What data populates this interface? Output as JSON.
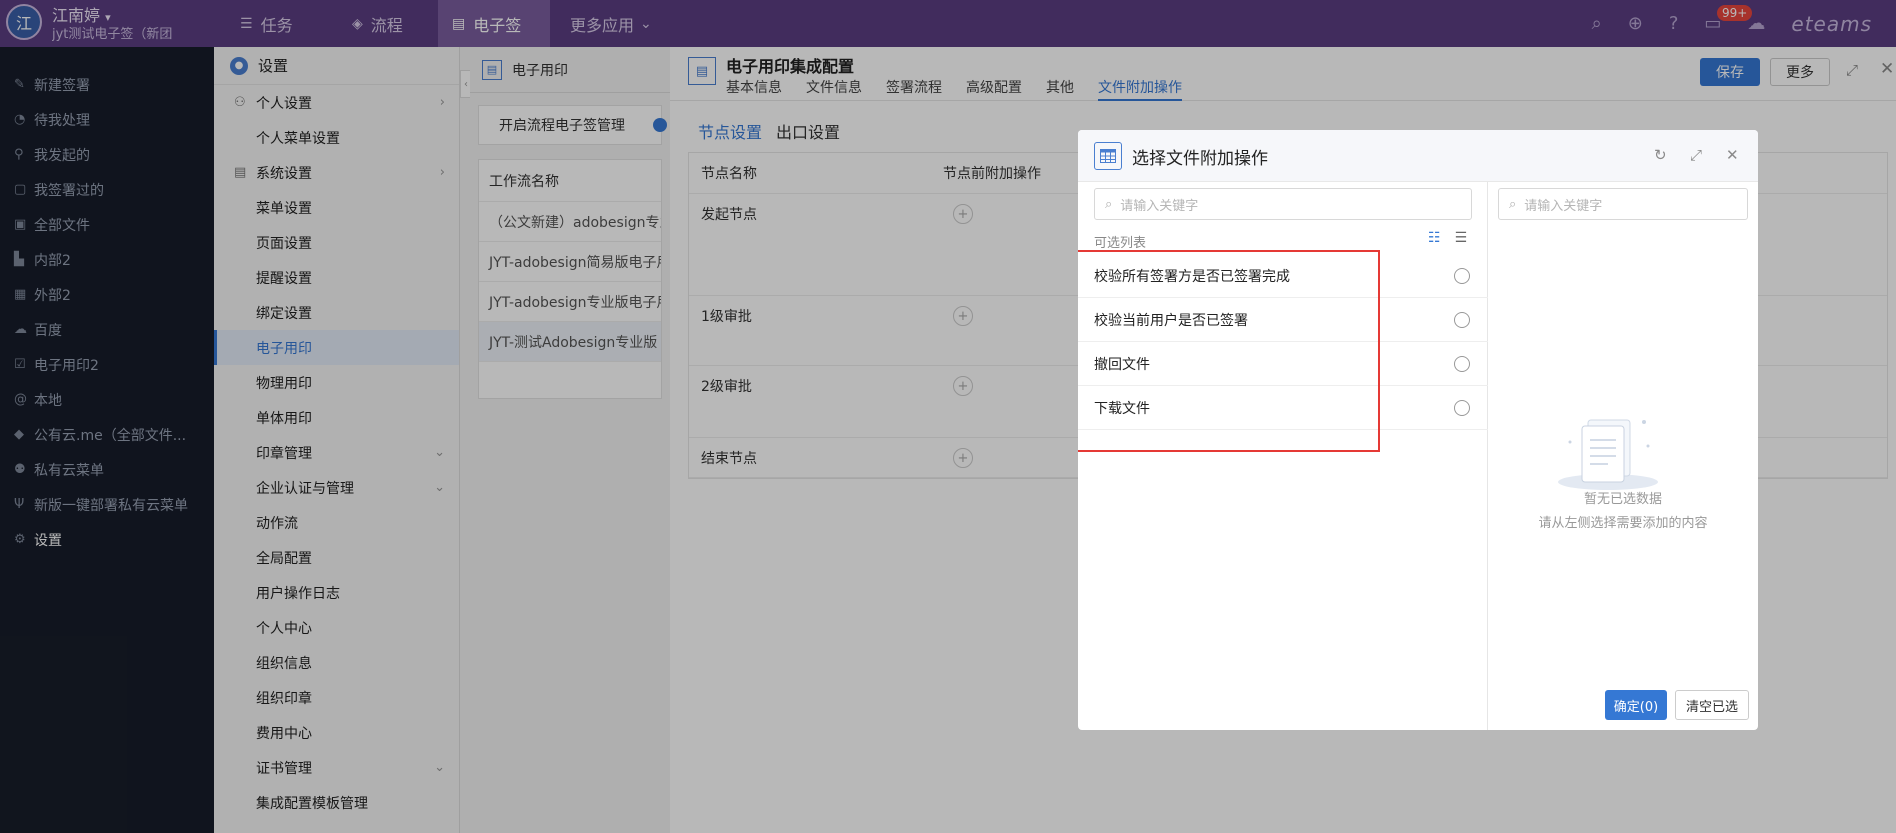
{
  "topbar": {
    "avatar": "江",
    "user_name": "江南婷",
    "user_org": "jyt测试电子签（新团",
    "nav": [
      {
        "label": "任务",
        "icon": "list-icon"
      },
      {
        "label": "流程",
        "icon": "workflow-icon"
      },
      {
        "label": "电子签",
        "icon": "doc-sign-icon"
      },
      {
        "label": "更多应用",
        "icon": "chevron-down-icon"
      }
    ],
    "badge": "99+",
    "brand": "eteams"
  },
  "leftnav": {
    "items": [
      {
        "label": "新建签署",
        "icon": "new-sign-icon"
      },
      {
        "label": "待我处理",
        "icon": "pending-icon"
      },
      {
        "label": "我发起的",
        "icon": "initiated-icon"
      },
      {
        "label": "我签署过的",
        "icon": "signed-icon"
      },
      {
        "label": "全部文件",
        "icon": "files-icon"
      },
      {
        "label": "内部2",
        "icon": "chart-icon"
      },
      {
        "label": "外部2",
        "icon": "grid-icon"
      },
      {
        "label": "百度",
        "icon": "cloud-icon"
      },
      {
        "label": "电子用印2",
        "icon": "check-icon"
      },
      {
        "label": "本地",
        "icon": "at-icon"
      },
      {
        "label": "公有云.me（全部文件...",
        "icon": "layers-icon"
      },
      {
        "label": "私有云菜单",
        "icon": "users-icon"
      },
      {
        "label": "新版一键部署私有云菜单",
        "icon": "fork-icon"
      },
      {
        "label": "设置",
        "icon": "gear-icon"
      }
    ]
  },
  "settings_menu": {
    "header": "设置",
    "items": [
      {
        "label": "个人设置",
        "type": "group",
        "icon": "person-icon",
        "arrow": "right"
      },
      {
        "label": "个人菜单设置",
        "type": "item"
      },
      {
        "label": "系统设置",
        "type": "group",
        "icon": "system-icon",
        "arrow": "right"
      },
      {
        "label": "菜单设置",
        "type": "item"
      },
      {
        "label": "页面设置",
        "type": "item"
      },
      {
        "label": "提醒设置",
        "type": "item"
      },
      {
        "label": "绑定设置",
        "type": "item"
      },
      {
        "label": "电子用印",
        "type": "item",
        "active": true
      },
      {
        "label": "物理用印",
        "type": "item"
      },
      {
        "label": "单体用印",
        "type": "item"
      },
      {
        "label": "印章管理",
        "type": "item",
        "arrow": "down"
      },
      {
        "label": "企业认证与管理",
        "type": "item",
        "arrow": "down"
      },
      {
        "label": "动作流",
        "type": "item"
      },
      {
        "label": "全局配置",
        "type": "item"
      },
      {
        "label": "用户操作日志",
        "type": "item"
      },
      {
        "label": "个人中心",
        "type": "item"
      },
      {
        "label": "组织信息",
        "type": "item"
      },
      {
        "label": "组织印章",
        "type": "item"
      },
      {
        "label": "费用中心",
        "type": "item"
      },
      {
        "label": "证书管理",
        "type": "item",
        "arrow": "down"
      },
      {
        "label": "集成配置模板管理",
        "type": "item"
      }
    ]
  },
  "workflow_panel": {
    "title": "电子用印",
    "toggle_label": "开启流程电子签管理",
    "column_header": "工作流名称",
    "rows": [
      "（公文新建）adobesign专业版",
      "JYT-adobesign简易版电子用印",
      "JYT-adobesign专业版电子用印",
      "JYT-测试Adobesign专业版"
    ]
  },
  "main": {
    "title": "电子用印集成配置",
    "tabs": [
      "基本信息",
      "文件信息",
      "签署流程",
      "高级配置",
      "其他",
      "文件附加操作"
    ],
    "active_tab": "文件附加操作",
    "save_label": "保存",
    "more_label": "更多",
    "subtabs": [
      "节点设置",
      "出口设置"
    ],
    "table": {
      "headers": [
        "节点名称",
        "节点前附加操作"
      ],
      "nodes": [
        "发起节点",
        "1级审批",
        "2级审批",
        "结束节点"
      ]
    }
  },
  "modal": {
    "title": "选择文件附加操作",
    "left_search_placeholder": "请输入关键字",
    "right_search_placeholder": "请输入关键字",
    "list_label": "可选列表",
    "options": [
      "校验所有签署方是否已签署完成",
      "校验当前用户是否已签署",
      "撤回文件",
      "下载文件"
    ],
    "empty_title": "暂无已选数据",
    "empty_hint": "请从左侧选择需要添加的内容",
    "confirm_label": "确定(0)",
    "clear_label": "清空已选"
  }
}
